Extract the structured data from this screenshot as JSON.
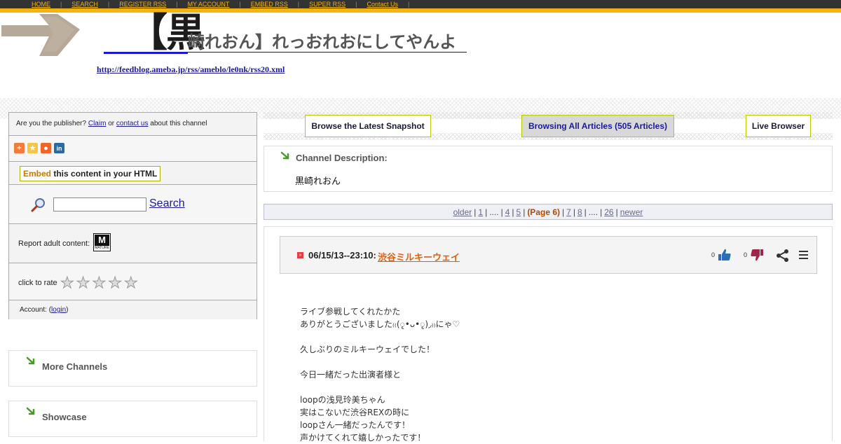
{
  "nav": {
    "items": [
      "HOME",
      "SEARCH",
      "REGISTER RSS",
      "MY ACCOUNT",
      "EMBED RSS",
      "SUPER RSS",
      "Contact Us"
    ]
  },
  "header": {
    "title_big": "【黒",
    "title_small": "崎れおん】れっおれおにしてやんよ",
    "feed_url": "http://feedblog.ameba.jp/rss/ameblo/le0nk/rss20.xml"
  },
  "sidebar": {
    "publisher_q": "Are you the publisher?",
    "claim": "Claim",
    "or": "or",
    "contact_us": "contact us",
    "about": "about this channel",
    "share_icons": [
      "plus-share-icon",
      "star-share-icon",
      "reddit-icon",
      "linkedin-icon"
    ],
    "embed_word": "Embed",
    "embed_rest": "this content in your HTML",
    "search_label": "Search",
    "search_value": "",
    "report_label": "Report adult content:",
    "mature_badge_top": "M",
    "mature_badge_bottom": "MATURE",
    "rate_label": "click to rate",
    "account_prefix": "Account: (",
    "account_login": "login",
    "account_suffix": ")",
    "more_channels": "More Channels",
    "showcase": "Showcase"
  },
  "tabs": {
    "latest": "Browse the Latest Snapshot",
    "all": "Browsing All Articles (505 Articles)",
    "live": "Live Browser"
  },
  "description": {
    "heading": "Channel Description:",
    "text": "黒崎れおん"
  },
  "pager": {
    "older": "older",
    "p1": "1",
    "dots1": "....",
    "p4": "4",
    "p5": "5",
    "current": "(Page 6)",
    "p7": "7",
    "p8": "8",
    "dots2": "....",
    "p26": "26",
    "newer": "newer"
  },
  "article": {
    "date": "06/15/13--23:10:",
    "title": "渋谷ミルキーウェイ",
    "likes": "0",
    "dislikes": "0",
    "body": "ライブ参戦してくれたかた\nありがとうございました₍₍(ृ•ᴗ•ृ)◞₎₎にゃ♡\n\n久しぶりのミルキーウェイでした！\n\n今日一緒だった出演者様と\n\nloopの浅見玲美ちゃん\n実はこないだ渋谷REXの時に\nloopさん一緒だったんです！\n声かけてくれて嬉しかったです！"
  },
  "colors": {
    "accent": "#f2b315",
    "nav_bg": "#333333",
    "link": "#1a1a99",
    "article_link": "#e06010",
    "current_page": "#b34a00"
  }
}
